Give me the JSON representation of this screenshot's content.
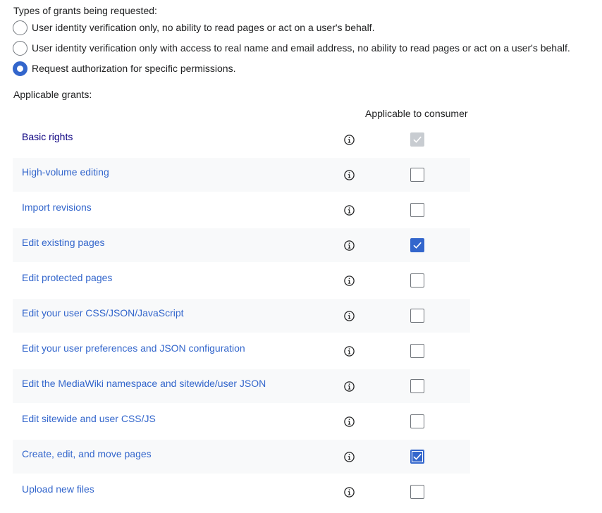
{
  "grant_types": {
    "heading": "Types of grants being requested:",
    "options": [
      {
        "label": "User identity verification only, no ability to read pages or act on a user's behalf.",
        "selected": false
      },
      {
        "label": "User identity verification only with access to real name and email address, no ability to read pages or act on a user's behalf.",
        "selected": false
      },
      {
        "label": "Request authorization for specific permissions.",
        "selected": true
      }
    ]
  },
  "applicable_grants": {
    "heading": "Applicable grants:",
    "column_header": "Applicable to consumer",
    "info_icon": "info-icon",
    "accent_color": "#3366cc",
    "rows": [
      {
        "label": "Basic rights",
        "checked": true,
        "disabled": true
      },
      {
        "label": "High-volume editing",
        "checked": false,
        "disabled": false
      },
      {
        "label": "Import revisions",
        "checked": false,
        "disabled": false
      },
      {
        "label": "Edit existing pages",
        "checked": true,
        "disabled": false
      },
      {
        "label": "Edit protected pages",
        "checked": false,
        "disabled": false
      },
      {
        "label": "Edit your user CSS/JSON/JavaScript",
        "checked": false,
        "disabled": false
      },
      {
        "label": "Edit your user preferences and JSON configuration",
        "checked": false,
        "disabled": false
      },
      {
        "label": "Edit the MediaWiki namespace and sitewide/user JSON",
        "checked": false,
        "disabled": false
      },
      {
        "label": "Edit sitewide and user CSS/JS",
        "checked": false,
        "disabled": false
      },
      {
        "label": "Create, edit, and move pages",
        "checked": true,
        "disabled": false
      },
      {
        "label": "Upload new files",
        "checked": false,
        "disabled": false
      }
    ]
  }
}
